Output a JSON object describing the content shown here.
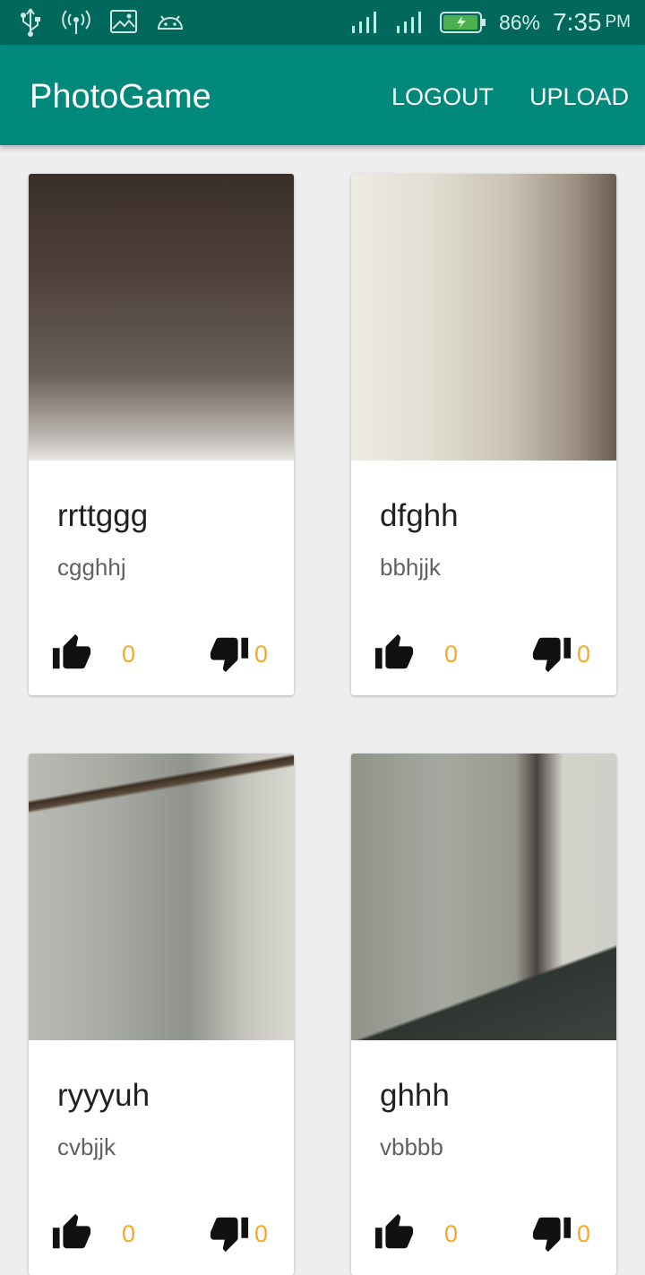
{
  "status_bar": {
    "battery_percent": "86%",
    "time": "7:35",
    "ampm": "PM",
    "icons": [
      "usb-icon",
      "hotspot-icon",
      "image-icon",
      "android-icon",
      "signal-icon",
      "battery-charging-icon"
    ]
  },
  "app_bar": {
    "title": "PhotoGame",
    "actions": [
      {
        "label": "LOGOUT"
      },
      {
        "label": "UPLOAD"
      }
    ]
  },
  "colors": {
    "status_bar": "#00695c",
    "app_bar": "#00897b",
    "counter": "#f9a825",
    "background": "#eeeeee"
  },
  "cards": [
    {
      "title": "rrttggg",
      "subtitle": "cgghhj",
      "likes": "0",
      "dislikes": "0"
    },
    {
      "title": "dfghh",
      "subtitle": "bbhjjk",
      "likes": "0",
      "dislikes": "0"
    },
    {
      "title": "ryyyuh",
      "subtitle": "cvbjjk",
      "likes": "0",
      "dislikes": "0"
    },
    {
      "title": "ghhh",
      "subtitle": "vbbbb",
      "likes": "0",
      "dislikes": "0"
    }
  ]
}
